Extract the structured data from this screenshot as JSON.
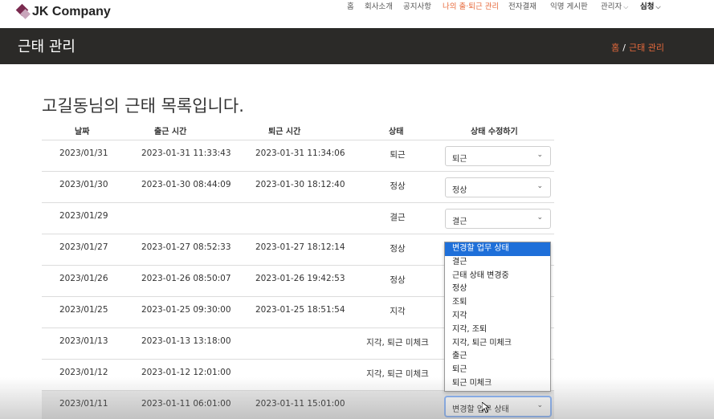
{
  "brand": {
    "name": "JK Company"
  },
  "nav": {
    "items": [
      "홈",
      "회사소개",
      "공지사항",
      "나의 출·퇴근 관리",
      "전자결재",
      "익명 게시판",
      "관리자",
      "심청"
    ]
  },
  "page": {
    "title": "근태 관리",
    "breadcrumb_home": "홈",
    "breadcrumb_sep": "/",
    "breadcrumb_current": "근태 관리",
    "heading": "고길동님의 근태 목록입니다."
  },
  "table": {
    "headers": [
      "날짜",
      "출근 시간",
      "퇴근 시간",
      "상태",
      "상태 수정하기"
    ],
    "rows": [
      {
        "date": "2023/01/31",
        "in": "2023-01-31 11:33:43",
        "out": "2023-01-31 11:34:06",
        "status": "퇴근",
        "select": "퇴근"
      },
      {
        "date": "2023/01/30",
        "in": "2023-01-30 08:44:09",
        "out": "2023-01-30 18:12:40",
        "status": "정상",
        "select": "정상"
      },
      {
        "date": "2023/01/29",
        "in": "",
        "out": "",
        "status": "결근",
        "select": "결근"
      },
      {
        "date": "2023/01/27",
        "in": "2023-01-27 08:52:33",
        "out": "2023-01-27 18:12:14",
        "status": "정상",
        "select": ""
      },
      {
        "date": "2023/01/26",
        "in": "2023-01-26 08:50:07",
        "out": "2023-01-26 19:42:53",
        "status": "정상",
        "select": ""
      },
      {
        "date": "2023/01/25",
        "in": "2023-01-25 09:30:00",
        "out": "2023-01-25 18:51:54",
        "status": "지각",
        "select": ""
      },
      {
        "date": "2023/01/13",
        "in": "2023-01-13 13:18:00",
        "out": "",
        "status": "지각, 퇴근 미체크",
        "select": ""
      },
      {
        "date": "2023/01/12",
        "in": "2023-01-12 12:01:00",
        "out": "",
        "status": "지각, 퇴근 미체크",
        "select": ""
      },
      {
        "date": "2023/01/11",
        "in": "2023-01-11 06:01:00",
        "out": "2023-01-11 15:01:00",
        "status": "",
        "select": "변경할 업무 상태"
      }
    ]
  },
  "dropdown": {
    "options": [
      "변경할 업무 상태",
      "결근",
      "근태 상태 변경중",
      "정상",
      "조퇴",
      "지각",
      "지각, 조퇴",
      "지각, 퇴근 미체크",
      "출근",
      "퇴근",
      "퇴근 미체크"
    ],
    "highlighted": "변경할 업무 상태"
  },
  "colors": {
    "accent": "#e76a3c",
    "titlebar": "#2b2a28",
    "highlight": "#1e6fd9"
  }
}
